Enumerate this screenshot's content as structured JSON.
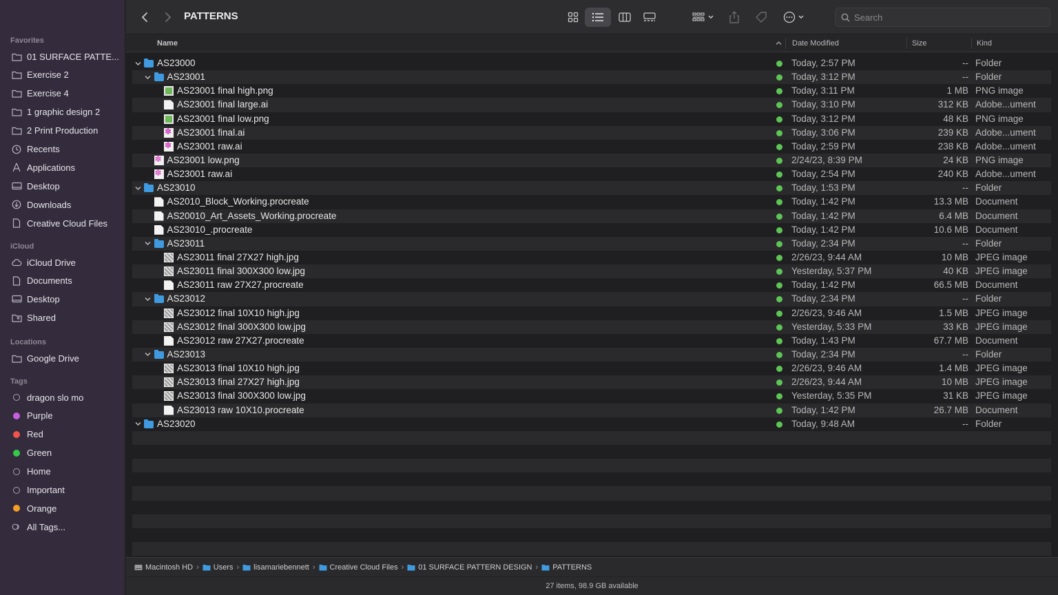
{
  "sidebar": {
    "sections": {
      "favorites": "Favorites",
      "icloud": "iCloud",
      "locations": "Locations",
      "tags": "Tags"
    },
    "favorites": [
      {
        "label": "01 SURFACE PATTE...",
        "icon": "folder-icon"
      },
      {
        "label": "Exercise 2",
        "icon": "folder-icon"
      },
      {
        "label": "Exercise 4",
        "icon": "folder-icon"
      },
      {
        "label": "1 graphic design 2",
        "icon": "folder-icon"
      },
      {
        "label": "2 Print Production",
        "icon": "folder-icon"
      },
      {
        "label": "Recents",
        "icon": "clock-icon"
      },
      {
        "label": "Applications",
        "icon": "applications-icon"
      },
      {
        "label": "Desktop",
        "icon": "desktop-icon"
      },
      {
        "label": "Downloads",
        "icon": "download-icon"
      },
      {
        "label": "Creative Cloud Files",
        "icon": "document-icon"
      }
    ],
    "icloud": [
      {
        "label": "iCloud Drive",
        "icon": "cloud-icon"
      },
      {
        "label": "Documents",
        "icon": "document-icon"
      },
      {
        "label": "Desktop",
        "icon": "desktop-icon"
      },
      {
        "label": "Shared",
        "icon": "shared-folder-icon"
      }
    ],
    "locations": [
      {
        "label": "Google Drive",
        "icon": "folder-icon"
      }
    ],
    "tags": [
      {
        "label": "dragon slo mo",
        "color": ""
      },
      {
        "label": "Purple",
        "color": "#c65ee0"
      },
      {
        "label": "Red",
        "color": "#f0544c"
      },
      {
        "label": "Green",
        "color": "#35c84a"
      },
      {
        "label": "Home",
        "color": ""
      },
      {
        "label": "Important",
        "color": ""
      },
      {
        "label": "Orange",
        "color": "#f4a028"
      },
      {
        "label": "All Tags...",
        "color": "all"
      }
    ]
  },
  "toolbar": {
    "title": "PATTERNS",
    "search_placeholder": "Search"
  },
  "columns": {
    "name": "Name",
    "date": "Date Modified",
    "size": "Size",
    "kind": "Kind"
  },
  "rows": [
    {
      "name": "AS23000",
      "level": 0,
      "type": "folder",
      "expanded": true,
      "date": "Today, 2:57 PM",
      "size": "--",
      "kind": "Folder"
    },
    {
      "name": "AS23001",
      "level": 1,
      "type": "folder",
      "expanded": true,
      "date": "Today, 3:12 PM",
      "size": "--",
      "kind": "Folder"
    },
    {
      "name": "AS23001 final high.png",
      "level": 2,
      "type": "png",
      "date": "Today, 3:11 PM",
      "size": "1 MB",
      "kind": "PNG image"
    },
    {
      "name": "AS23001 final large.ai",
      "level": 2,
      "type": "doc",
      "date": "Today, 3:10 PM",
      "size": "312 KB",
      "kind": "Adobe...ument"
    },
    {
      "name": "AS23001 final low.png",
      "level": 2,
      "type": "png",
      "date": "Today, 3:12 PM",
      "size": "48 KB",
      "kind": "PNG image"
    },
    {
      "name": "AS23001 final.ai",
      "level": 2,
      "type": "ai",
      "date": "Today, 3:06 PM",
      "size": "239 KB",
      "kind": "Adobe...ument"
    },
    {
      "name": "AS23001 raw.ai",
      "level": 2,
      "type": "ai",
      "date": "Today, 2:59 PM",
      "size": "238 KB",
      "kind": "Adobe...ument"
    },
    {
      "name": "AS23001 low.png",
      "level": 1,
      "type": "pink",
      "date": "2/24/23, 8:39 PM",
      "size": "24 KB",
      "kind": "PNG image"
    },
    {
      "name": "AS23001 raw.ai",
      "level": 1,
      "type": "pink",
      "date": "Today, 2:54 PM",
      "size": "240 KB",
      "kind": "Adobe...ument"
    },
    {
      "name": "AS23010",
      "level": 0,
      "type": "folder",
      "expanded": true,
      "date": "Today, 1:53 PM",
      "size": "--",
      "kind": "Folder"
    },
    {
      "name": "AS2010_Block_Working.procreate",
      "level": 1,
      "type": "doc",
      "date": "Today, 1:42 PM",
      "size": "13.3 MB",
      "kind": "Document"
    },
    {
      "name": "AS20010_Art_Assets_Working.procreate",
      "level": 1,
      "type": "doc",
      "date": "Today, 1:42 PM",
      "size": "6.4 MB",
      "kind": "Document"
    },
    {
      "name": "AS23010_.procreate",
      "level": 1,
      "type": "doc",
      "date": "Today, 1:42 PM",
      "size": "10.6 MB",
      "kind": "Document"
    },
    {
      "name": "AS23011",
      "level": 1,
      "type": "folder",
      "expanded": true,
      "date": "Today, 2:34 PM",
      "size": "--",
      "kind": "Folder"
    },
    {
      "name": "AS23011 final 27X27 high.jpg",
      "level": 2,
      "type": "jpg",
      "date": "2/26/23, 9:44 AM",
      "size": "10 MB",
      "kind": "JPEG image"
    },
    {
      "name": "AS23011 final 300X300 low.jpg",
      "level": 2,
      "type": "jpg",
      "date": "Yesterday, 5:37 PM",
      "size": "40 KB",
      "kind": "JPEG image"
    },
    {
      "name": "AS23011 raw 27X27.procreate",
      "level": 2,
      "type": "doc",
      "date": "Today, 1:42 PM",
      "size": "66.5 MB",
      "kind": "Document"
    },
    {
      "name": "AS23012",
      "level": 1,
      "type": "folder",
      "expanded": true,
      "date": "Today, 2:34 PM",
      "size": "--",
      "kind": "Folder"
    },
    {
      "name": "AS23012 final 10X10 high.jpg",
      "level": 2,
      "type": "jpg",
      "date": "2/26/23, 9:46 AM",
      "size": "1.5 MB",
      "kind": "JPEG image"
    },
    {
      "name": "AS23012 final 300X300 low.jpg",
      "level": 2,
      "type": "jpg",
      "date": "Yesterday, 5:33 PM",
      "size": "33 KB",
      "kind": "JPEG image"
    },
    {
      "name": "AS23012 raw 27X27.procreate",
      "level": 2,
      "type": "doc",
      "date": "Today, 1:43 PM",
      "size": "67.7 MB",
      "kind": "Document"
    },
    {
      "name": "AS23013",
      "level": 1,
      "type": "folder",
      "expanded": true,
      "date": "Today, 2:34 PM",
      "size": "--",
      "kind": "Folder"
    },
    {
      "name": "AS23013 final 10X10 high.jpg",
      "level": 2,
      "type": "jpg",
      "date": "2/26/23, 9:46 AM",
      "size": "1.4 MB",
      "kind": "JPEG image"
    },
    {
      "name": "AS23013 final 27X27 high.jpg",
      "level": 2,
      "type": "jpg",
      "date": "2/26/23, 9:44 AM",
      "size": "10 MB",
      "kind": "JPEG image"
    },
    {
      "name": "AS23013 final 300X300 low.jpg",
      "level": 2,
      "type": "jpg",
      "date": "Yesterday, 5:35 PM",
      "size": "31 KB",
      "kind": "JPEG image"
    },
    {
      "name": "AS23013 raw 10X10.procreate",
      "level": 2,
      "type": "doc",
      "date": "Today, 1:42 PM",
      "size": "26.7 MB",
      "kind": "Document"
    },
    {
      "name": "AS23020",
      "level": 0,
      "type": "folder",
      "expanded": true,
      "date": "Today, 9:48 AM",
      "size": "--",
      "kind": "Folder"
    }
  ],
  "pathbar": [
    {
      "label": "Macintosh HD",
      "icon": "disk-icon"
    },
    {
      "label": "Users",
      "icon": "folder-icon"
    },
    {
      "label": "lisamariebennett",
      "icon": "folder-icon"
    },
    {
      "label": "Creative Cloud Files",
      "icon": "folder-icon"
    },
    {
      "label": "01 SURFACE PATTERN DESIGN",
      "icon": "folder-icon"
    },
    {
      "label": "PATTERNS",
      "icon": "folder-icon"
    }
  ],
  "status": "27 items, 98.9 GB available",
  "colors": {
    "sidebar_bg": "#342c3c",
    "folder": "#3f9ae0",
    "sync_ok": "#5ec456"
  }
}
